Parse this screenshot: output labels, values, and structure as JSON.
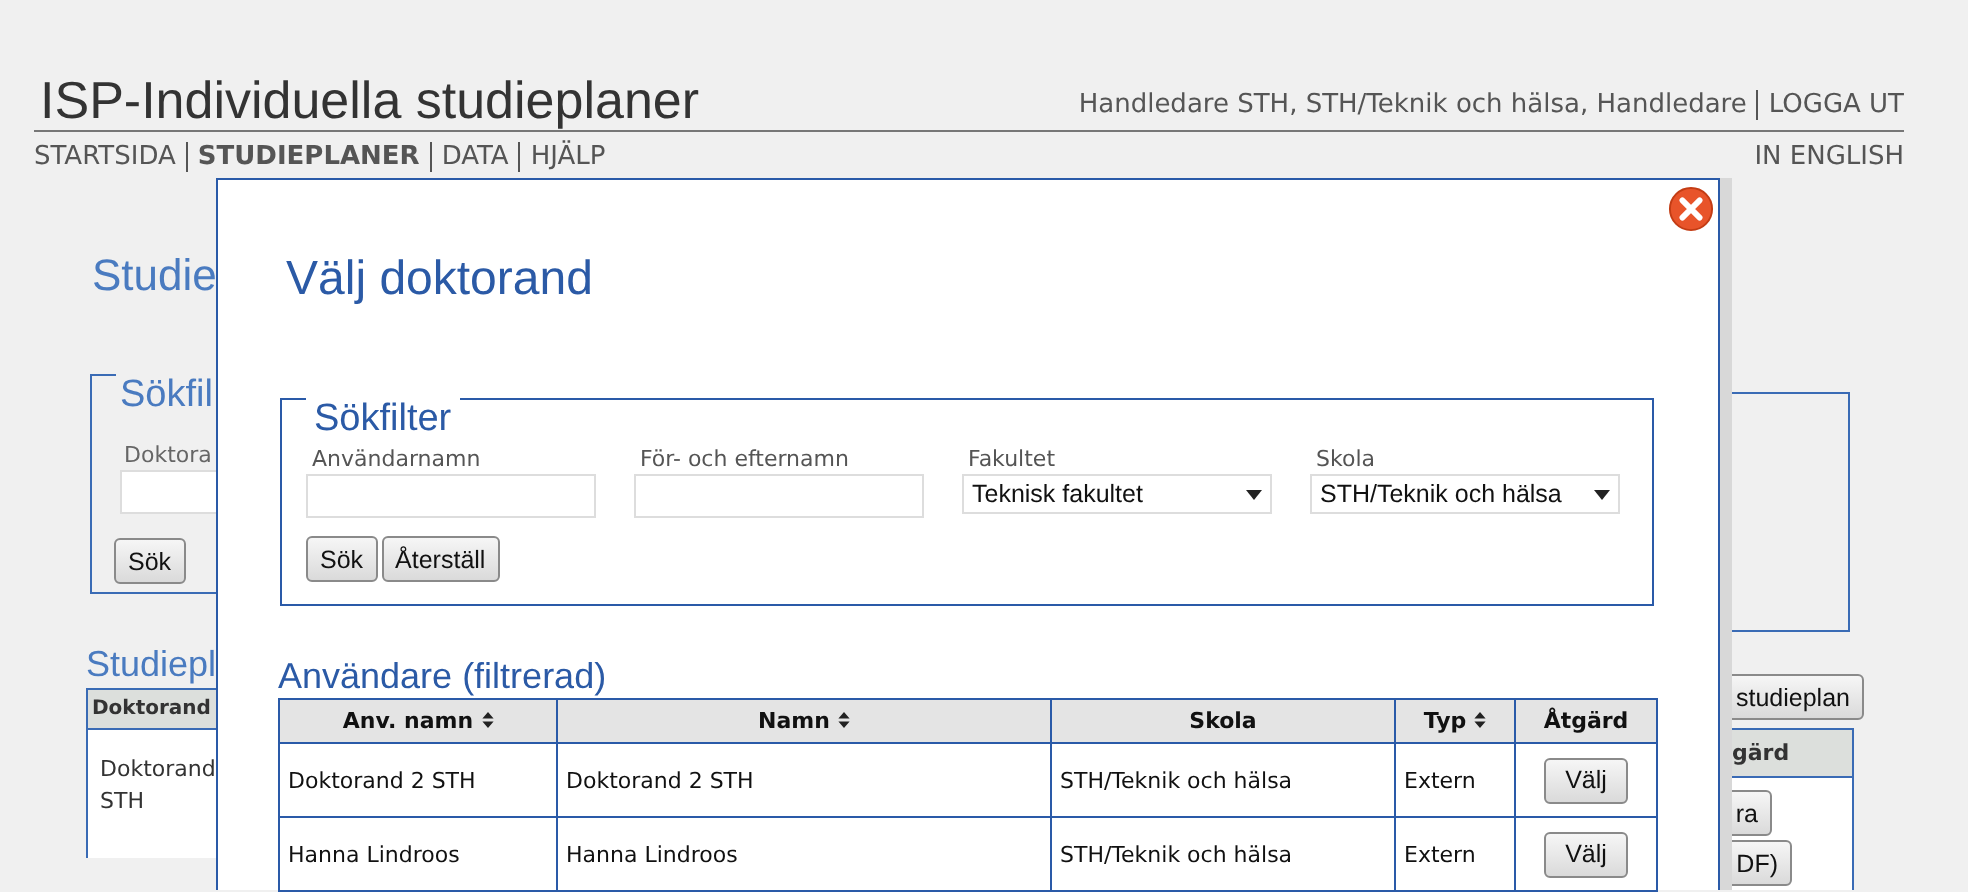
{
  "header": {
    "title": "ISP-Individuella studieplaner",
    "user": "Handledare STH, STH/Teknik och hälsa, Handledare",
    "logout": "LOGGA UT"
  },
  "nav": {
    "items": [
      {
        "label": "STARTSIDA",
        "selected": false
      },
      {
        "label": "STUDIEPLANER",
        "selected": true
      },
      {
        "label": "DATA",
        "selected": false
      },
      {
        "label": "HJÄLP",
        "selected": false
      }
    ],
    "language": "IN ENGLISH"
  },
  "background_left": {
    "heading": "Studie",
    "filter_legend": "Sökfil",
    "field_label": "Doktora",
    "search_button": "Sök",
    "section_heading": "Studiepl",
    "table_header": "Doktorand",
    "cell_lines": [
      "Doktorand",
      "STH"
    ]
  },
  "background_right": {
    "button": "studieplan",
    "table_header": "gärd",
    "row_buttons": [
      "ra",
      "DF)"
    ]
  },
  "dialog": {
    "title": "Välj doktorand",
    "filter": {
      "legend": "Sökfilter",
      "fields": [
        {
          "kind": "text",
          "label": "Användarnamn"
        },
        {
          "kind": "text",
          "label": "För- och efternamn"
        },
        {
          "kind": "select",
          "label": "Fakultet",
          "value": "Teknisk fakultet"
        },
        {
          "kind": "select",
          "label": "Skola",
          "value": "STH/Teknik och hälsa"
        }
      ],
      "buttons": [
        "Sök",
        "Återställ"
      ]
    },
    "table": {
      "title": "Användare (filtrerad)",
      "columns": [
        {
          "label": "Anv. namn",
          "sortable": true
        },
        {
          "label": "Namn",
          "sortable": true
        },
        {
          "label": "Skola",
          "sortable": false
        },
        {
          "label": "Typ",
          "sortable": true
        },
        {
          "label": "Åtgärd",
          "sortable": false
        }
      ],
      "rows": [
        {
          "cells": [
            "Doktorand 2 STH",
            "Doktorand 2 STH",
            "STH/Teknik och hälsa",
            "Extern"
          ],
          "action": "Välj"
        },
        {
          "cells": [
            "Hanna Lindroos",
            "Hanna Lindroos",
            "STH/Teknik och hälsa",
            "Extern"
          ],
          "action": "Välj"
        }
      ]
    }
  }
}
